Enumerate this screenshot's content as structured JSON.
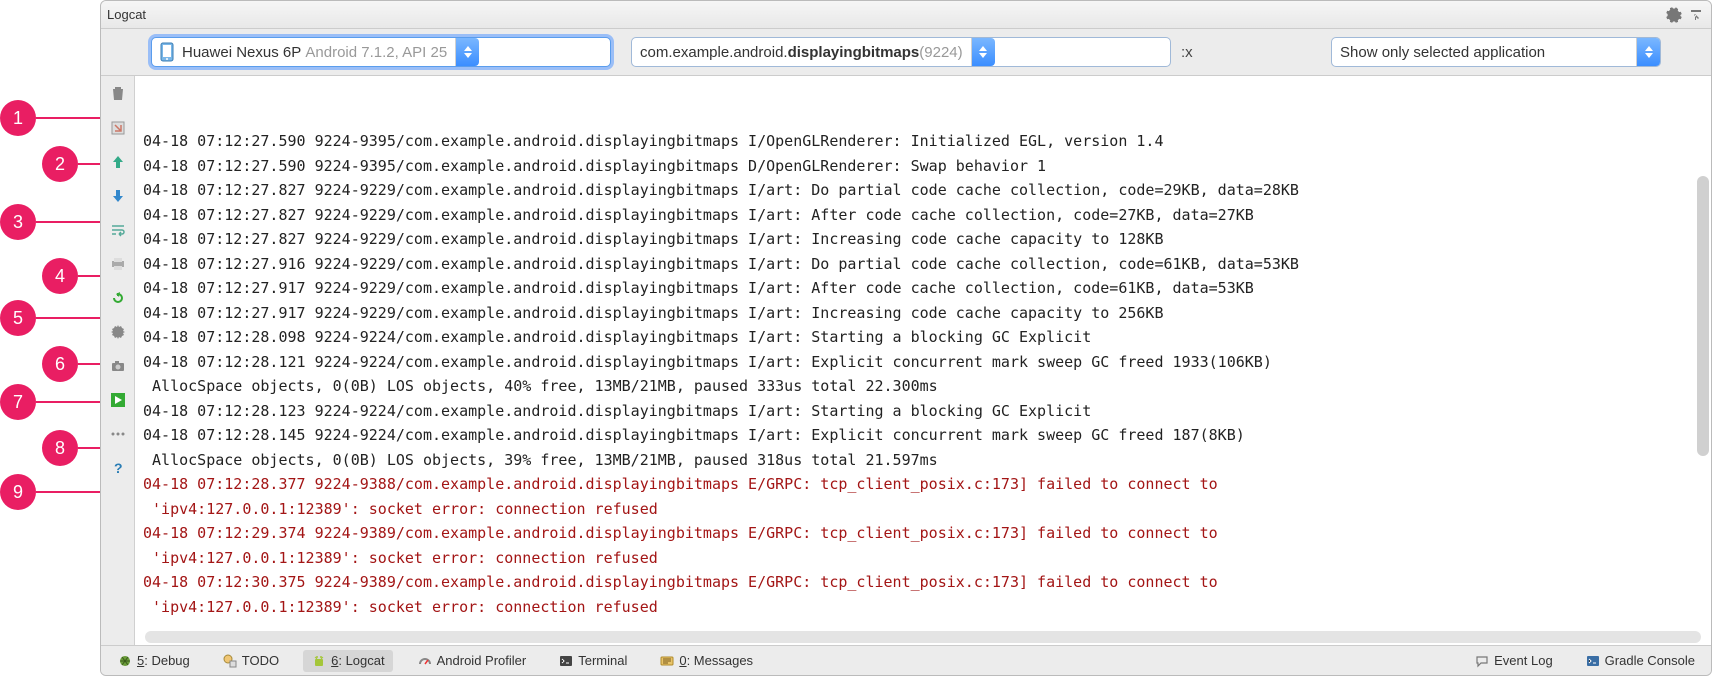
{
  "title": "Logcat",
  "callouts": [
    "1",
    "2",
    "3",
    "4",
    "5",
    "6",
    "7",
    "8",
    "9"
  ],
  "filter": {
    "device_name": "Huawei Nexus 6P",
    "device_os": "Android 7.1.2, API 25",
    "process_prefix": "com.example.android.",
    "process_bold": "displayingbitmaps",
    "process_pid": " (9224)",
    "regex_hint": ":x",
    "scope": "Show only selected application"
  },
  "gutter_icons": [
    "trash",
    "scroll-end",
    "arrow-up",
    "arrow-down",
    "wrap",
    "print",
    "restart",
    "gear",
    "camera",
    "record",
    "dots",
    "help"
  ],
  "log_lines": [
    {
      "t": "n",
      "s": "04-18 07:12:27.590 9224-9395/com.example.android.displayingbitmaps I/OpenGLRenderer: Initialized EGL, version 1.4"
    },
    {
      "t": "n",
      "s": "04-18 07:12:27.590 9224-9395/com.example.android.displayingbitmaps D/OpenGLRenderer: Swap behavior 1"
    },
    {
      "t": "n",
      "s": "04-18 07:12:27.827 9224-9229/com.example.android.displayingbitmaps I/art: Do partial code cache collection, code=29KB, data=28KB"
    },
    {
      "t": "n",
      "s": "04-18 07:12:27.827 9224-9229/com.example.android.displayingbitmaps I/art: After code cache collection, code=27KB, data=27KB"
    },
    {
      "t": "n",
      "s": "04-18 07:12:27.827 9224-9229/com.example.android.displayingbitmaps I/art: Increasing code cache capacity to 128KB"
    },
    {
      "t": "n",
      "s": "04-18 07:12:27.916 9224-9229/com.example.android.displayingbitmaps I/art: Do partial code cache collection, code=61KB, data=53KB"
    },
    {
      "t": "n",
      "s": "04-18 07:12:27.917 9224-9229/com.example.android.displayingbitmaps I/art: After code cache collection, code=61KB, data=53KB"
    },
    {
      "t": "n",
      "s": "04-18 07:12:27.917 9224-9229/com.example.android.displayingbitmaps I/art: Increasing code cache capacity to 256KB"
    },
    {
      "t": "n",
      "s": "04-18 07:12:28.098 9224-9224/com.example.android.displayingbitmaps I/art: Starting a blocking GC Explicit"
    },
    {
      "t": "n",
      "s": "04-18 07:12:28.121 9224-9224/com.example.android.displayingbitmaps I/art: Explicit concurrent mark sweep GC freed 1933(106KB)"
    },
    {
      "t": "n",
      "s": " AllocSpace objects, 0(0B) LOS objects, 40% free, 13MB/21MB, paused 333us total 22.300ms"
    },
    {
      "t": "n",
      "s": "04-18 07:12:28.123 9224-9224/com.example.android.displayingbitmaps I/art: Starting a blocking GC Explicit"
    },
    {
      "t": "n",
      "s": "04-18 07:12:28.145 9224-9224/com.example.android.displayingbitmaps I/art: Explicit concurrent mark sweep GC freed 187(8KB)"
    },
    {
      "t": "n",
      "s": " AllocSpace objects, 0(0B) LOS objects, 39% free, 13MB/21MB, paused 318us total 21.597ms"
    },
    {
      "t": "e",
      "s": "04-18 07:12:28.377 9224-9388/com.example.android.displayingbitmaps E/GRPC: tcp_client_posix.c:173] failed to connect to"
    },
    {
      "t": "e",
      "s": " 'ipv4:127.0.0.1:12389': socket error: connection refused"
    },
    {
      "t": "e",
      "s": "04-18 07:12:29.374 9224-9389/com.example.android.displayingbitmaps E/GRPC: tcp_client_posix.c:173] failed to connect to"
    },
    {
      "t": "e",
      "s": " 'ipv4:127.0.0.1:12389': socket error: connection refused"
    },
    {
      "t": "e",
      "s": "04-18 07:12:30.375 9224-9389/com.example.android.displayingbitmaps E/GRPC: tcp_client_posix.c:173] failed to connect to"
    },
    {
      "t": "e",
      "s": " 'ipv4:127.0.0.1:12389': socket error: connection refused"
    }
  ],
  "bottom_tabs": {
    "debug": {
      "n": "5",
      "l": ": Debug"
    },
    "todo": "TODO",
    "logcat": {
      "n": "6",
      "l": ": Logcat"
    },
    "profiler": "Android Profiler",
    "terminal": "Terminal",
    "messages": {
      "n": "0",
      "l": ": Messages"
    },
    "eventlog": "Event Log",
    "gradle": "Gradle Console"
  }
}
